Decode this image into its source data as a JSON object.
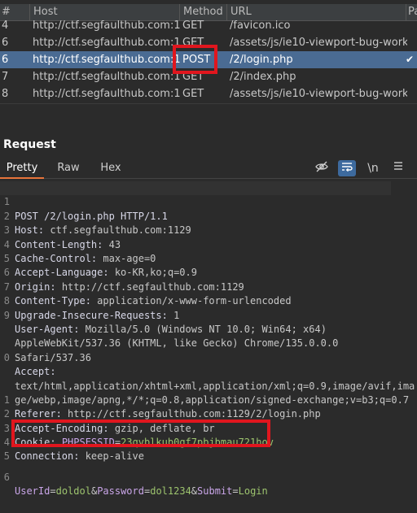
{
  "history": {
    "columns": {
      "num": "#",
      "host": "Host",
      "method": "Method",
      "url": "URL",
      "params": "Pa"
    },
    "rows": [
      {
        "num": "4",
        "host": "http://ctf.segfaulthub.com:1...",
        "method": "GET",
        "url": "/favicon.ico",
        "selected": false
      },
      {
        "num": "6",
        "host": "http://ctf.segfaulthub.com:1...",
        "method": "GET",
        "url": "/assets/js/ie10-viewport-bug-work...",
        "selected": false
      },
      {
        "num": "6",
        "host": "http://ctf.segfaulthub.com:1...",
        "method": "POST",
        "url": "/2/login.php",
        "selected": true,
        "check": "✔"
      },
      {
        "num": "7",
        "host": "http://ctf.segfaulthub.com:1...",
        "method": "GET",
        "url": "/2/index.php",
        "selected": false
      },
      {
        "num": "8",
        "host": "http://ctf.segfaulthub.com:1...",
        "method": "GET",
        "url": "/assets/js/ie10-viewport-bug-work...",
        "selected": false
      }
    ]
  },
  "request": {
    "title": "Request",
    "tabs": [
      "Pretty",
      "Raw",
      "Hex"
    ],
    "active_tab": "Pretty",
    "toolbar": {
      "hide_icon": "eye-off-icon",
      "wrap_icon": "word-wrap-icon",
      "newline_label": "\\n",
      "menu_icon": "hamburger-menu-icon"
    },
    "lines": [
      {
        "num": "1",
        "text": "POST /2/login.php HTTP/1.1"
      },
      {
        "num": "2",
        "key": "Host",
        "value": "ctf.segfaulthub.com:1129"
      },
      {
        "num": "3",
        "key": "Content-Length",
        "value": "43"
      },
      {
        "num": "4",
        "key": "Cache-Control",
        "value": "max-age=0"
      },
      {
        "num": "5",
        "key": "Accept-Language",
        "value": "ko-KR,ko;q=0.9"
      },
      {
        "num": "6",
        "key": "Origin",
        "value": "http://ctf.segfaulthub.com:1129"
      },
      {
        "num": "7",
        "key": "Content-Type",
        "value": "application/x-www-form-urlencoded"
      },
      {
        "num": "8",
        "key": "Upgrade-Insecure-Requests",
        "value": "1"
      },
      {
        "num": "9",
        "key": "User-Agent",
        "value": "Mozilla/5.0 (Windows NT 10.0; Win64; x64)"
      },
      {
        "num": "",
        "text": "AppleWebKit/537.36 (KHTML, like Gecko) Chrome/135.0.0.0"
      },
      {
        "num": "",
        "text": "Safari/537.36"
      },
      {
        "num": "0",
        "key": "Accept",
        "value": ""
      },
      {
        "num": "",
        "text": "text/html,application/xhtml+xml,application/xml;q=0.9,image/avif,ima"
      },
      {
        "num": "",
        "text": "ge/webp,image/apng,*/*;q=0.8,application/signed-exchange;v=b3;q=0.7"
      },
      {
        "num": "1",
        "key": "Referer",
        "value": "http://ctf.segfaulthub.com:1129/2/login.php"
      },
      {
        "num": "2",
        "key": "Accept-Encoding",
        "value": "gzip, deflate, br"
      },
      {
        "num": "3",
        "key": "Cookie",
        "cookie_name": "PHPSESSID",
        "cookie_value": "23qvblkub0gf7pbjbmau721hov"
      },
      {
        "num": "4",
        "key": "Connection",
        "value": "keep-alive"
      },
      {
        "num": "5",
        "text": ""
      },
      {
        "num": "6",
        "body": [
          {
            "name": "UserId",
            "value": "doldol"
          },
          {
            "name": "Password",
            "value": "dol1234"
          },
          {
            "name": "Submit",
            "value": "Login"
          }
        ]
      }
    ]
  },
  "colors": {
    "highlight": "#e0161e",
    "selected_row": "#4a6b93",
    "active_tab_underline": "#e8743b",
    "param_name": "#c9a5e8",
    "param_value": "#9dc46e"
  }
}
